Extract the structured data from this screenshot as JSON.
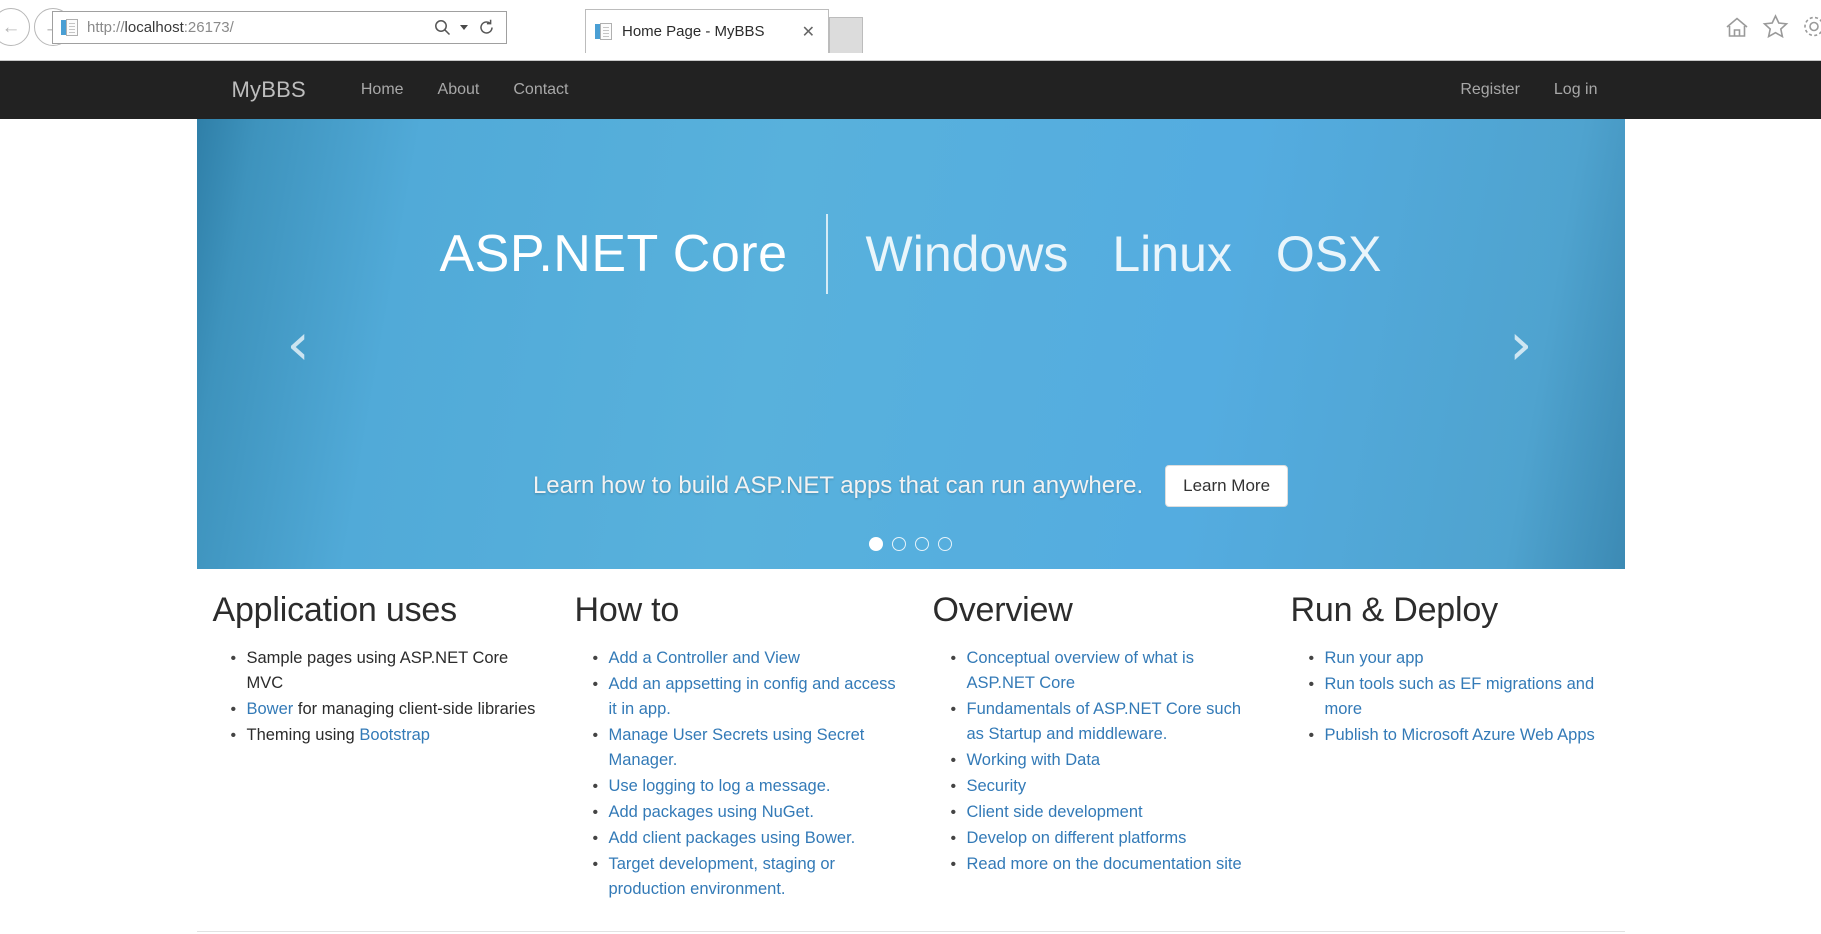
{
  "browser": {
    "back_icon": "arrow-left-icon",
    "forward_icon": "arrow-right-icon",
    "url": "http://localhost:26173/",
    "url_scheme": "http://",
    "url_host": "localhost",
    "url_port": ":26173/",
    "search_icon": "search-icon",
    "search_caret_icon": "chevron-down-icon",
    "refresh_icon": "refresh-icon",
    "tab": {
      "title": "Home Page - MyBBS",
      "close_label": "✕",
      "favicon": "page-favicon"
    },
    "new_tab_label": "",
    "home_icon": "home-icon",
    "favorites_icon": "star-icon",
    "settings_icon": "gear-icon"
  },
  "site_nav": {
    "brand": "MyBBS",
    "links": [
      {
        "label": "Home"
      },
      {
        "label": "About"
      },
      {
        "label": "Contact"
      }
    ],
    "right_links": [
      {
        "label": "Register"
      },
      {
        "label": "Log in"
      }
    ]
  },
  "carousel": {
    "headline_main": "ASP.NET Core",
    "headline_os": [
      "Windows",
      "Linux",
      "OSX"
    ],
    "prev_icon": "chevron-left-icon",
    "next_icon": "chevron-right-icon",
    "prev_glyph": "‹",
    "next_glyph": "›",
    "caption": "Learn how to build ASP.NET apps that can run anywhere.",
    "button_label": "Learn More",
    "slide_count": 4,
    "active_slide": 1,
    "accent_color": "#4fa8d6"
  },
  "columns": [
    {
      "title": "Application uses",
      "items": [
        {
          "text": "Sample pages using ASP.NET Core MVC",
          "link": false
        },
        {
          "text": "Bower for managing client-side libraries",
          "link": false,
          "link_prefix": "Bower"
        },
        {
          "text": "Theming using Bootstrap",
          "link": false,
          "link_suffix": "Bootstrap"
        }
      ]
    },
    {
      "title": "How to",
      "items": [
        {
          "text": "Add a Controller and View",
          "link": true
        },
        {
          "text": "Add an appsetting in config and access it in app.",
          "link": true
        },
        {
          "text": "Manage User Secrets using Secret Manager.",
          "link": true
        },
        {
          "text": "Use logging to log a message.",
          "link": true
        },
        {
          "text": "Add packages using NuGet.",
          "link": true
        },
        {
          "text": "Add client packages using Bower.",
          "link": true
        },
        {
          "text": "Target development, staging or production environment.",
          "link": true
        }
      ]
    },
    {
      "title": "Overview",
      "items": [
        {
          "text": "Conceptual overview of what is ASP.NET Core",
          "link": true
        },
        {
          "text": "Fundamentals of ASP.NET Core such as Startup and middleware.",
          "link": true
        },
        {
          "text": "Working with Data",
          "link": true
        },
        {
          "text": "Security",
          "link": true
        },
        {
          "text": "Client side development",
          "link": true
        },
        {
          "text": "Develop on different platforms",
          "link": true
        },
        {
          "text": "Read more on the documentation site",
          "link": true
        }
      ]
    },
    {
      "title": "Run & Deploy",
      "items": [
        {
          "text": "Run your app",
          "link": true
        },
        {
          "text": "Run tools such as EF migrations and more",
          "link": true
        },
        {
          "text": "Publish to Microsoft Azure Web Apps",
          "link": true
        }
      ]
    }
  ],
  "colors": {
    "navbar_bg": "#222222",
    "link_blue": "#337ab7",
    "hero_blue": "#4fa8d6"
  }
}
